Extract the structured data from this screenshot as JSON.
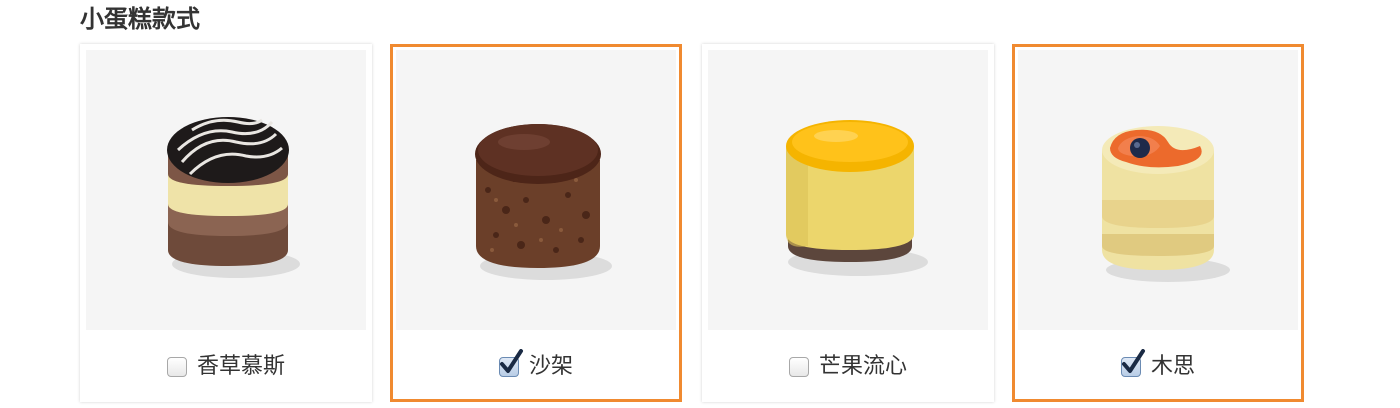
{
  "section": {
    "title": "小蛋糕款式"
  },
  "colors": {
    "selected_border": "#f08a30",
    "photo_background": "#f5f5f5",
    "text": "#333333"
  },
  "cakes": [
    {
      "label": "香草慕斯",
      "checked": false,
      "image": "vanilla-mousse-cake"
    },
    {
      "label": "沙架",
      "checked": true,
      "image": "chocolate-sacher-cake"
    },
    {
      "label": "芒果流心",
      "checked": false,
      "image": "mango-cake"
    },
    {
      "label": "木思",
      "checked": true,
      "image": "fruit-mousse-cake"
    }
  ]
}
